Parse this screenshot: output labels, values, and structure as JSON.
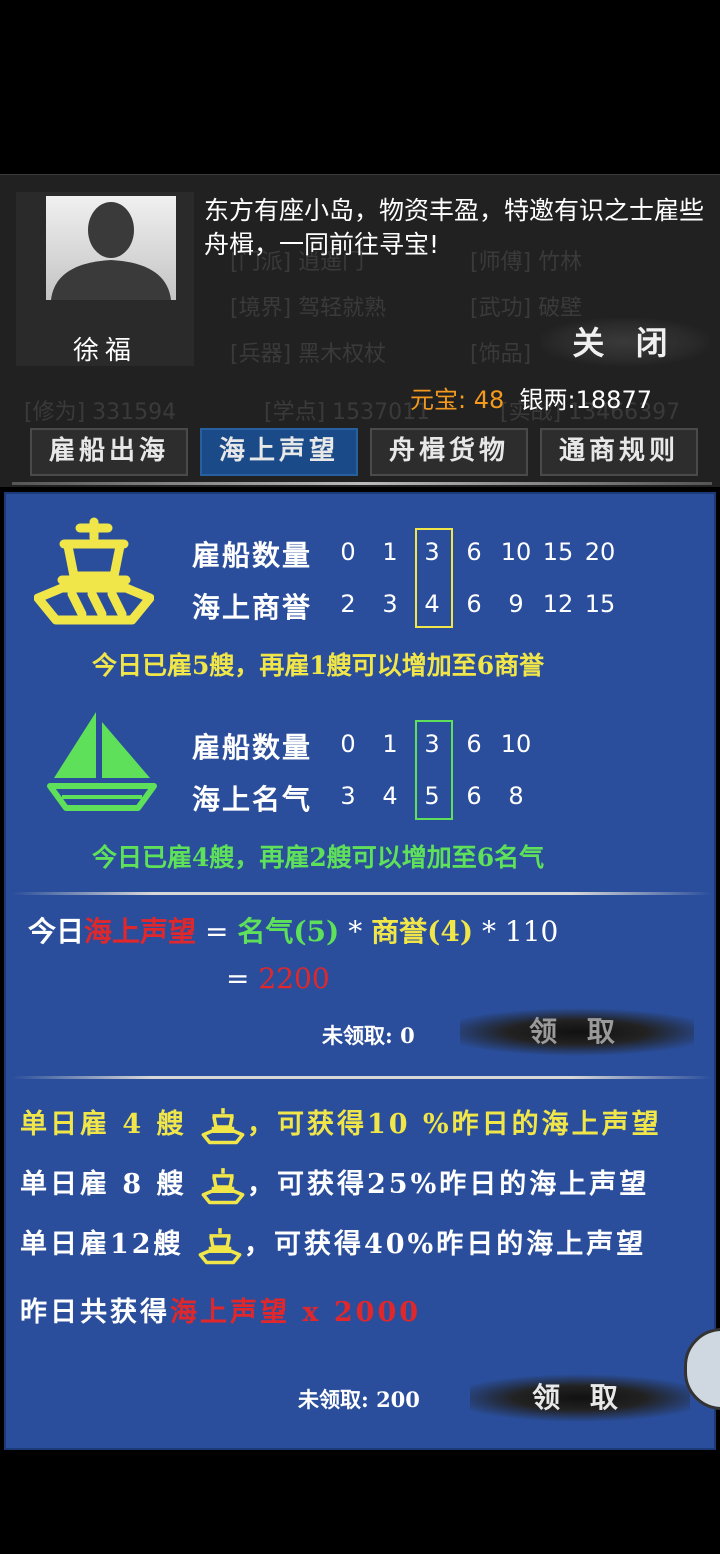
{
  "npc": {
    "name": "徐福",
    "dialog": "东方有座小岛，物资丰盈，特邀有识之士雇些舟楫，一同前往寻宝!"
  },
  "background_stats": {
    "line1_left": "[门派] 逍遥门",
    "line1_right": "[师傅] 竹林",
    "line2_left": "[境界] 驾轻就熟",
    "line2_right": "[武功] 破壁",
    "line3_left": "[兵器] 黑木权杖",
    "line3_right": "[饰品]",
    "line4_left": "[修为] 331594",
    "line4_mid": "[学点] 1537011",
    "line4_right": "[实战] 13466397"
  },
  "close_label": "关 闭",
  "currency": {
    "yuanbao_label": "元宝:",
    "yuanbao_value": "48",
    "silver_label": "银两:",
    "silver_value": "18877"
  },
  "tabs": [
    {
      "label": "雇船出海",
      "active": false
    },
    {
      "label": "海上声望",
      "active": true
    },
    {
      "label": "舟楫货物",
      "active": false
    },
    {
      "label": "通商规则",
      "active": false
    }
  ],
  "big_ship": {
    "icon": "junk-ship-icon",
    "color": "#f0e64a",
    "row1_label": "雇船数量",
    "row1_values": [
      "0",
      "1",
      "3",
      "6",
      "10",
      "15",
      "20"
    ],
    "row2_label": "海上商誉",
    "row2_values": [
      "2",
      "3",
      "4",
      "6",
      "9",
      "12",
      "15"
    ],
    "highlight_index": 2,
    "note": "今日已雇5艘，再雇1艘可以增加至6商誉"
  },
  "small_ship": {
    "icon": "sailboat-icon",
    "color": "#5fe05a",
    "row1_label": "雇船数量",
    "row1_values": [
      "0",
      "1",
      "3",
      "6",
      "10"
    ],
    "row2_label": "海上名气",
    "row2_values": [
      "3",
      "4",
      "5",
      "6",
      "8"
    ],
    "highlight_index": 2,
    "note": "今日已雇4艘，再雇2艘可以增加至6名气"
  },
  "formula": {
    "prefix": "今日",
    "term": "海上声望",
    "eq1": "=",
    "fame": "名气(5)",
    "times1": "*",
    "reputation": "商誉(4)",
    "times2": "* 110",
    "eq2": "=",
    "result": "2200"
  },
  "today_claim": {
    "pending_label": "未领取: 0",
    "button_label": "领 取"
  },
  "bonuses": [
    {
      "prefix": "单日雇 4 艘",
      "suffix": "，可获得10 %昨日的海上声望",
      "color": "#f0e64a"
    },
    {
      "prefix": "单日雇 8 艘",
      "suffix": "，可获得25%昨日的海上声望",
      "color": "#ffffff"
    },
    {
      "prefix": "单日雇12艘",
      "suffix": "，可获得40%昨日的海上声望",
      "color": "#ffffff"
    }
  ],
  "yesterday": {
    "label": "昨日共获得",
    "value": "海上声望 x 2000"
  },
  "yesterday_claim": {
    "pending_label": "未领取: 200",
    "button_label": "领 取"
  }
}
